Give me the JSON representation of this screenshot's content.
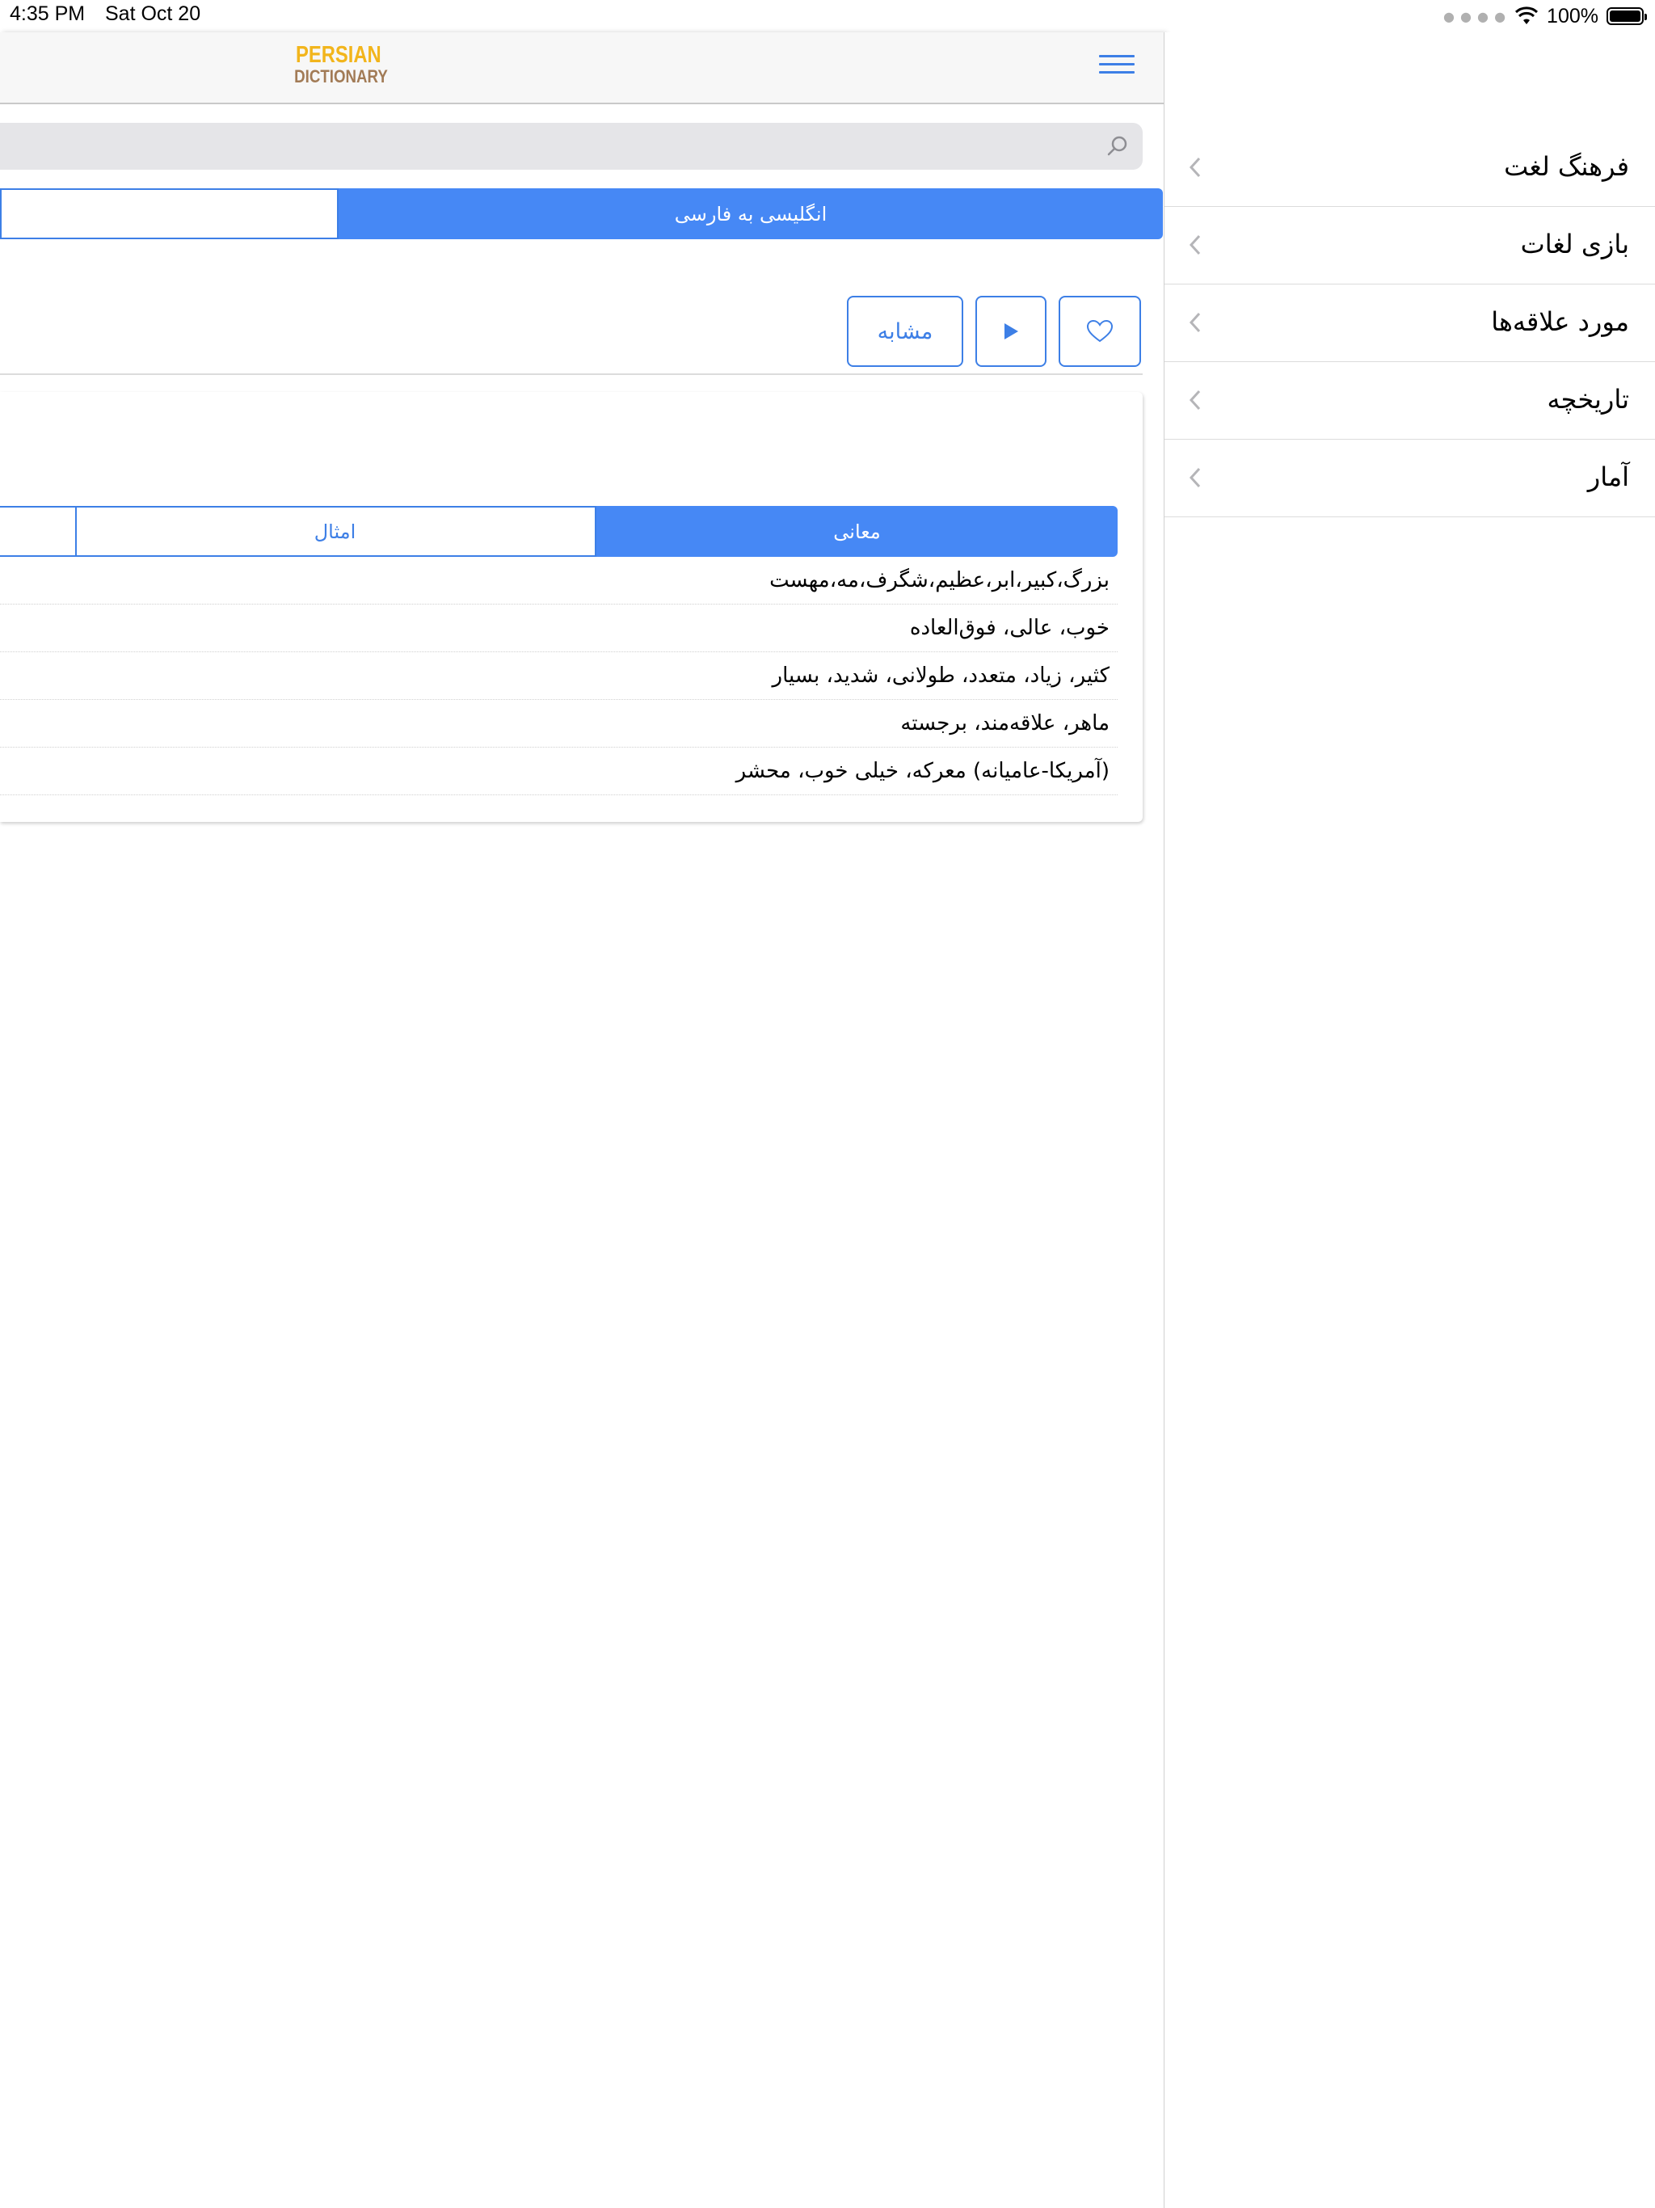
{
  "status_bar": {
    "time": "4:35 PM",
    "date": "Sat Oct 20",
    "battery_percent": "100%",
    "battery_level": 1.0
  },
  "header": {
    "logo_top": "PERSIAN",
    "logo_bottom": "DICTIONARY",
    "menu_icon": "hamburger-menu-icon"
  },
  "search": {
    "value": "",
    "icon": "search-icon"
  },
  "direction_tabs": {
    "active_label": "انگلیسی به فارسی",
    "inactive_label": ""
  },
  "actions": {
    "similar_label": "مشابه",
    "play_icon": "play-icon",
    "favorite_icon": "heart-icon"
  },
  "content_tabs": {
    "meanings_label": "معانی",
    "examples_label": "امثال",
    "third_label": ""
  },
  "meanings": [
    "بزرگ،کبیر،ابر،عظیم،شگرف،مه،مهست",
    "خوب، عالی، فوق‌العاده",
    "کثیر، زیاد، متعدد، طولانی، شدید، بسیار",
    "ماهر، علاقه‌مند، برجسته",
    "(آمریکا-عامیانه) معرکه، خیلی خوب، محشر"
  ],
  "side_menu": {
    "items": [
      {
        "label": "فرهنگ لغت"
      },
      {
        "label": "بازی لغات"
      },
      {
        "label": "مورد علاقه‌ها"
      },
      {
        "label": "تاریخچه"
      },
      {
        "label": "آمار"
      }
    ],
    "chevron_icon": "chevron-left-icon"
  },
  "colors": {
    "accent": "#4688F5",
    "logo_yellow": "#F2B51C",
    "logo_brown": "#A27B56"
  }
}
